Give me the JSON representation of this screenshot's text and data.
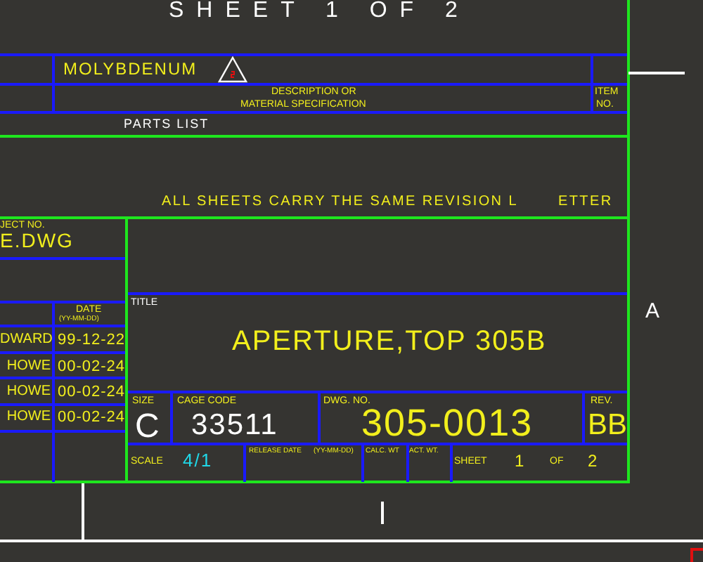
{
  "sheet_header": "SHEET 1 OF 2",
  "parts_list": {
    "material": "MOLYBDENUM",
    "description_heading": [
      "DESCRIPTION OR",
      "MATERIAL SPECIFICATION"
    ],
    "item_heading": [
      "ITEM",
      "NO."
    ],
    "caption": "PARTS LIST"
  },
  "notes": [
    "ALL SHEETS CARRY THE SAME REVISION L",
    "ETTER"
  ],
  "left_block": {
    "project_label": "JECT NO.",
    "file_name": "E.DWG",
    "date_heading": "DATE",
    "date_format": "(YY-MM-DD)",
    "approvals": [
      {
        "name": "DWARD",
        "date": "99-12-22"
      },
      {
        "name": "HOWE",
        "date": "00-02-24"
      },
      {
        "name": "HOWE",
        "date": "00-02-24"
      },
      {
        "name": "HOWE",
        "date": "00-02-24"
      }
    ]
  },
  "title_block": {
    "title_label": "TITLE",
    "title": "APERTURE,TOP 305B",
    "size_label": "SIZE",
    "size": "C",
    "cage_label": "CAGE CODE",
    "cage_code": "33511",
    "dwg_label": "DWG. NO.",
    "dwg_no": "305-0013",
    "rev_label": "REV.",
    "rev": "BB",
    "scale_label": "SCALE",
    "scale": "4/1",
    "release_label": "RELEASE DATE",
    "release_format": "(YY-MM-DD)",
    "calc_label": "CALC. WT",
    "act_label": "ACT. WT.",
    "sheet_label": "SHEET",
    "sheet": "1",
    "of_label": "OF",
    "sheet_count": "2"
  },
  "zone_label": "A"
}
